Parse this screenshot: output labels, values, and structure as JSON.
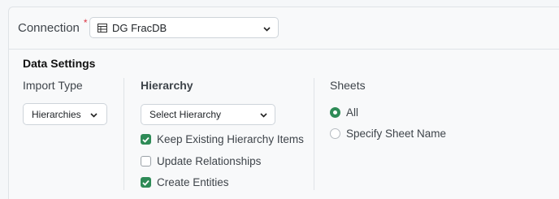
{
  "connection": {
    "label": "Connection",
    "required_mark": "*",
    "selected": "DG FracDB",
    "db_icon": "database-icon"
  },
  "data_settings": {
    "title": "Data Settings",
    "import_type": {
      "label": "Import Type",
      "selected": "Hierarchies"
    },
    "hierarchy": {
      "heading": "Hierarchy",
      "select_placeholder": "Select Hierarchy",
      "options": [
        {
          "label": "Keep Existing Hierarchy Items",
          "checked": true
        },
        {
          "label": "Update Relationships",
          "checked": false
        },
        {
          "label": "Create Entities",
          "checked": true
        }
      ]
    },
    "sheets": {
      "heading": "Sheets",
      "options": [
        {
          "label": "All",
          "selected": true
        },
        {
          "label": "Specify Sheet Name",
          "selected": false
        }
      ]
    }
  },
  "colors": {
    "accent": "#2e8b57",
    "required": "#dc3545"
  }
}
